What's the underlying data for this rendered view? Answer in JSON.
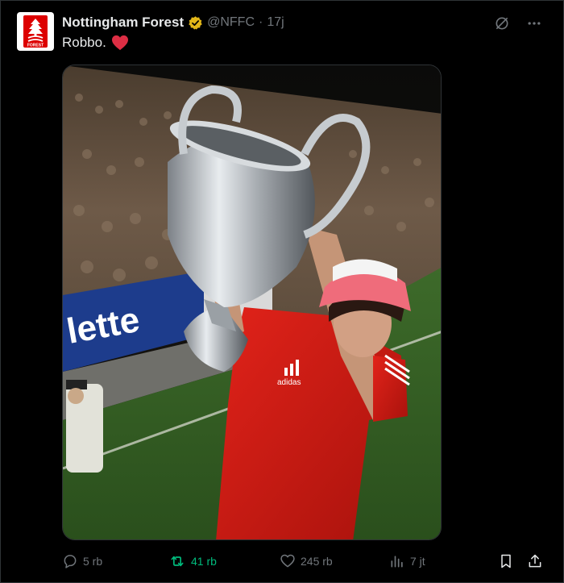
{
  "tweet": {
    "author_name": "Nottingham Forest",
    "handle": "@NFFC",
    "separator": "·",
    "time": "17j",
    "text": "Robbo.",
    "emoji_icon": "red-heart-icon",
    "avatar_icon": "nottingham-forest-crest-icon",
    "verified_color": "#e2b719"
  },
  "stats": {
    "replies": "5 rb",
    "reposts": "41 rb",
    "likes": "245 rb",
    "views": "7 jt"
  },
  "colors": {
    "background": "#000000",
    "text": "#e7e9ea",
    "muted": "#71767b",
    "repost_active": "#00ba7c",
    "heart": "#f91880",
    "forest_red": "#dd0000"
  },
  "media": {
    "description_icon": "photo-trophy-celebration"
  }
}
